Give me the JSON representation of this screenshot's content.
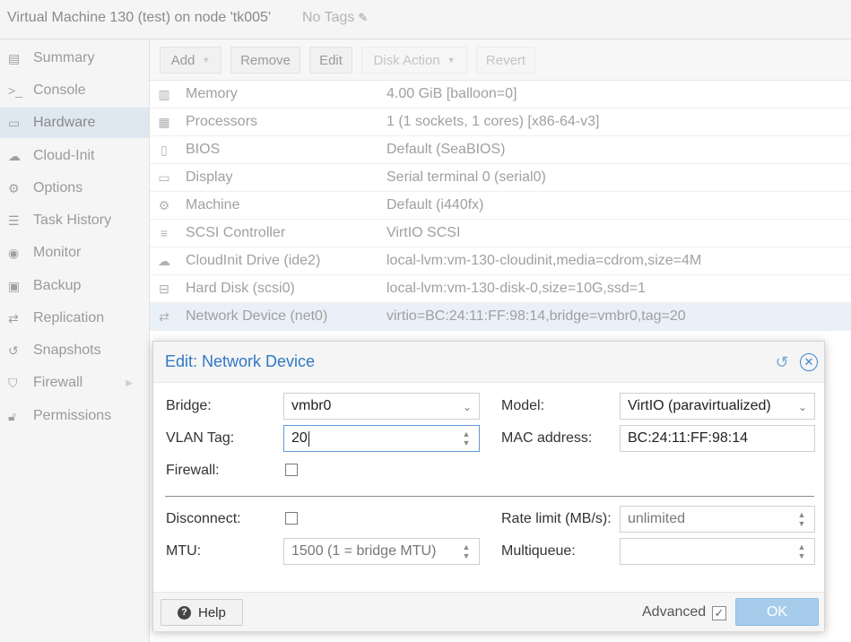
{
  "header": {
    "vm_title": "Virtual Machine 130 (test) on node 'tk005'",
    "tags_label": "No Tags"
  },
  "sidebar": {
    "items": [
      {
        "label": "Summary",
        "icon": "book-icon"
      },
      {
        "label": "Console",
        "icon": "terminal-icon"
      },
      {
        "label": "Hardware",
        "icon": "monitor-icon"
      },
      {
        "label": "Cloud-Init",
        "icon": "cloud-icon"
      },
      {
        "label": "Options",
        "icon": "gear-icon"
      },
      {
        "label": "Task History",
        "icon": "list-icon"
      },
      {
        "label": "Monitor",
        "icon": "eye-icon"
      },
      {
        "label": "Backup",
        "icon": "floppy-icon"
      },
      {
        "label": "Replication",
        "icon": "retweet-icon"
      },
      {
        "label": "Snapshots",
        "icon": "history-icon"
      },
      {
        "label": "Firewall",
        "icon": "shield-icon"
      },
      {
        "label": "Permissions",
        "icon": "unlock-icon"
      }
    ],
    "active": "Hardware"
  },
  "toolbar": {
    "add_label": "Add",
    "remove_label": "Remove",
    "edit_label": "Edit",
    "disk_action_label": "Disk Action",
    "revert_label": "Revert"
  },
  "hardware": {
    "rows": [
      {
        "name": "Memory",
        "value": "4.00 GiB [balloon=0]",
        "icon": "memory-icon"
      },
      {
        "name": "Processors",
        "value": "1 (1 sockets, 1 cores) [x86-64-v3]",
        "icon": "cpu-icon"
      },
      {
        "name": "BIOS",
        "value": "Default (SeaBIOS)",
        "icon": "microchip-icon"
      },
      {
        "name": "Display",
        "value": "Serial terminal 0 (serial0)",
        "icon": "desktop-icon"
      },
      {
        "name": "Machine",
        "value": "Default (i440fx)",
        "icon": "cogs-icon"
      },
      {
        "name": "SCSI Controller",
        "value": "VirtIO SCSI",
        "icon": "database-icon"
      },
      {
        "name": "CloudInit Drive (ide2)",
        "value": "local-lvm:vm-130-cloudinit,media=cdrom,size=4M",
        "icon": "cloud-icon"
      },
      {
        "name": "Hard Disk (scsi0)",
        "value": "local-lvm:vm-130-disk-0,size=10G,ssd=1",
        "icon": "hdd-icon"
      },
      {
        "name": "Network Device (net0)",
        "value": "virtio=BC:24:11:FF:98:14,bridge=vmbr0,tag=20",
        "icon": "exchange-icon"
      }
    ],
    "selected": "Network Device (net0)"
  },
  "dialog": {
    "title": "Edit: Network Device",
    "bridge_label": "Bridge:",
    "bridge_value": "vmbr0",
    "model_label": "Model:",
    "model_value": "VirtIO (paravirtualized)",
    "vlan_label": "VLAN Tag:",
    "vlan_value": "20",
    "mac_label": "MAC address:",
    "mac_value": "BC:24:11:FF:98:14",
    "firewall_label": "Firewall:",
    "disconnect_label": "Disconnect:",
    "rate_label": "Rate limit (MB/s):",
    "rate_placeholder": "unlimited",
    "mtu_label": "MTU:",
    "mtu_placeholder": "1500 (1 = bridge MTU)",
    "multiqueue_label": "Multiqueue:",
    "help_label": "Help",
    "advanced_label": "Advanced",
    "ok_label": "OK"
  },
  "colors": {
    "accent": "#2f78c4",
    "ok_button": "#a7cceb",
    "selected_row": "#eaf0f7"
  }
}
